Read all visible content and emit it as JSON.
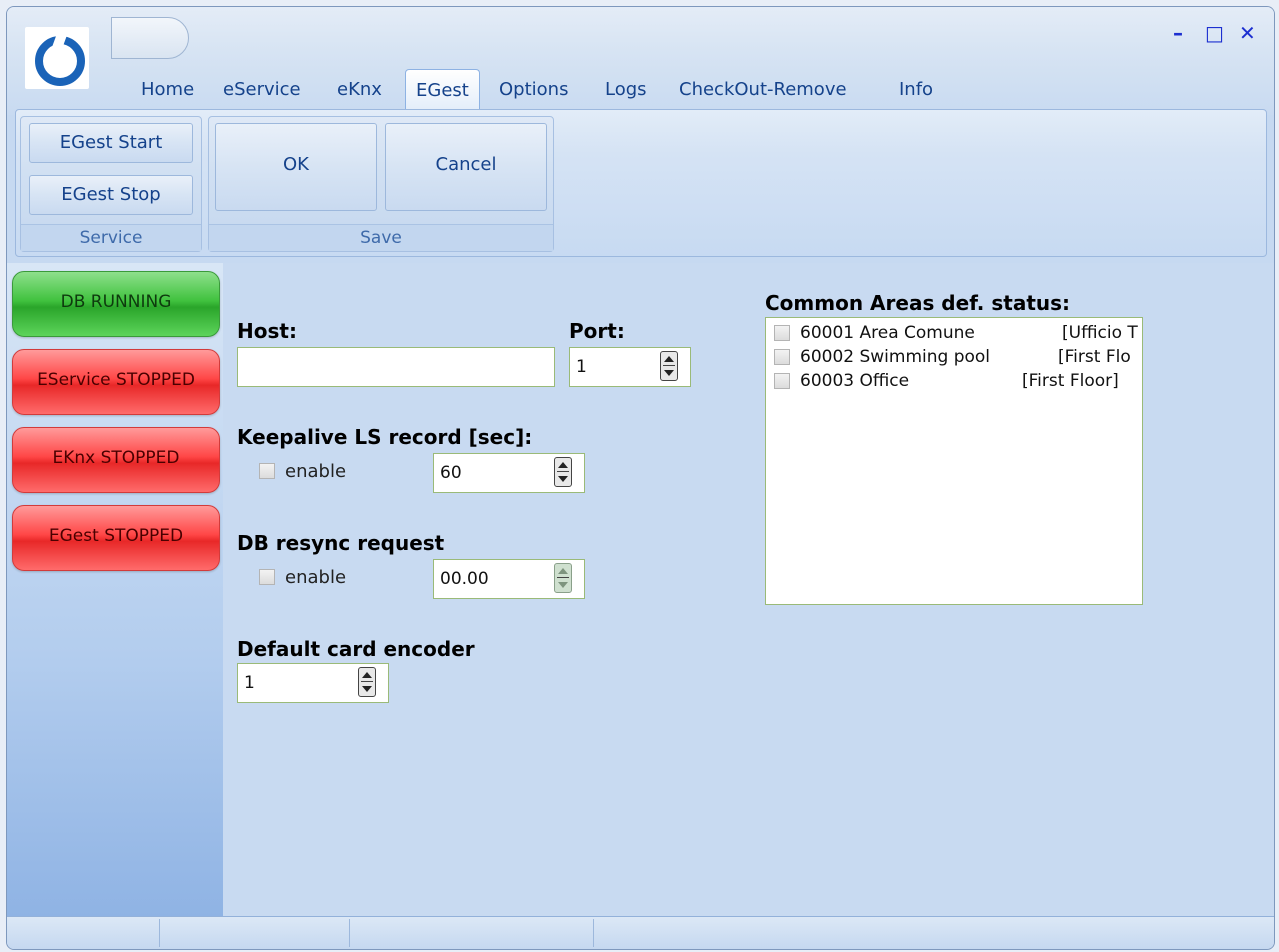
{
  "window_controls": {
    "minimize": "–",
    "maximize": "□",
    "close": "✕"
  },
  "logo_icon": "app-logo-icon",
  "tabs": [
    {
      "label": "Home"
    },
    {
      "label": "eService"
    },
    {
      "label": "eKnx"
    },
    {
      "label": "EGest",
      "active": true
    },
    {
      "label": "Options"
    },
    {
      "label": "Logs"
    },
    {
      "label": "CheckOut-Remove"
    },
    {
      "label": "Info"
    }
  ],
  "ribbon": {
    "service_group": {
      "label": "Service",
      "start": "EGest Start",
      "stop": "EGest Stop"
    },
    "save_group": {
      "label": "Save",
      "ok": "OK",
      "cancel": "Cancel"
    }
  },
  "status": {
    "db": "DB RUNNING",
    "eservice": "EService STOPPED",
    "eknx": "EKnx STOPPED",
    "egest": "EGest STOPPED",
    "colors": {
      "running": "#3cc13a",
      "stopped": "#ff3b3b"
    }
  },
  "form": {
    "host_label": "Host:",
    "host_value": "",
    "port_label": "Port:",
    "port_value": "1",
    "keepalive_label": "Keepalive LS record [sec]:",
    "keepalive_enable": "enable",
    "keepalive_value": "60",
    "resync_label": "DB resync request",
    "resync_enable": "enable",
    "resync_value": "00.00",
    "encoder_label": "Default card encoder",
    "encoder_value": "1"
  },
  "common_areas": {
    "label": "Common Areas def. status:",
    "items": [
      {
        "code": "60001 Area Comune",
        "location": "[Ufficio T"
      },
      {
        "code": "60002 Swimming pool",
        "location": "[First Flo"
      },
      {
        "code": "60003 Office",
        "location": "[First Floor]"
      }
    ]
  }
}
